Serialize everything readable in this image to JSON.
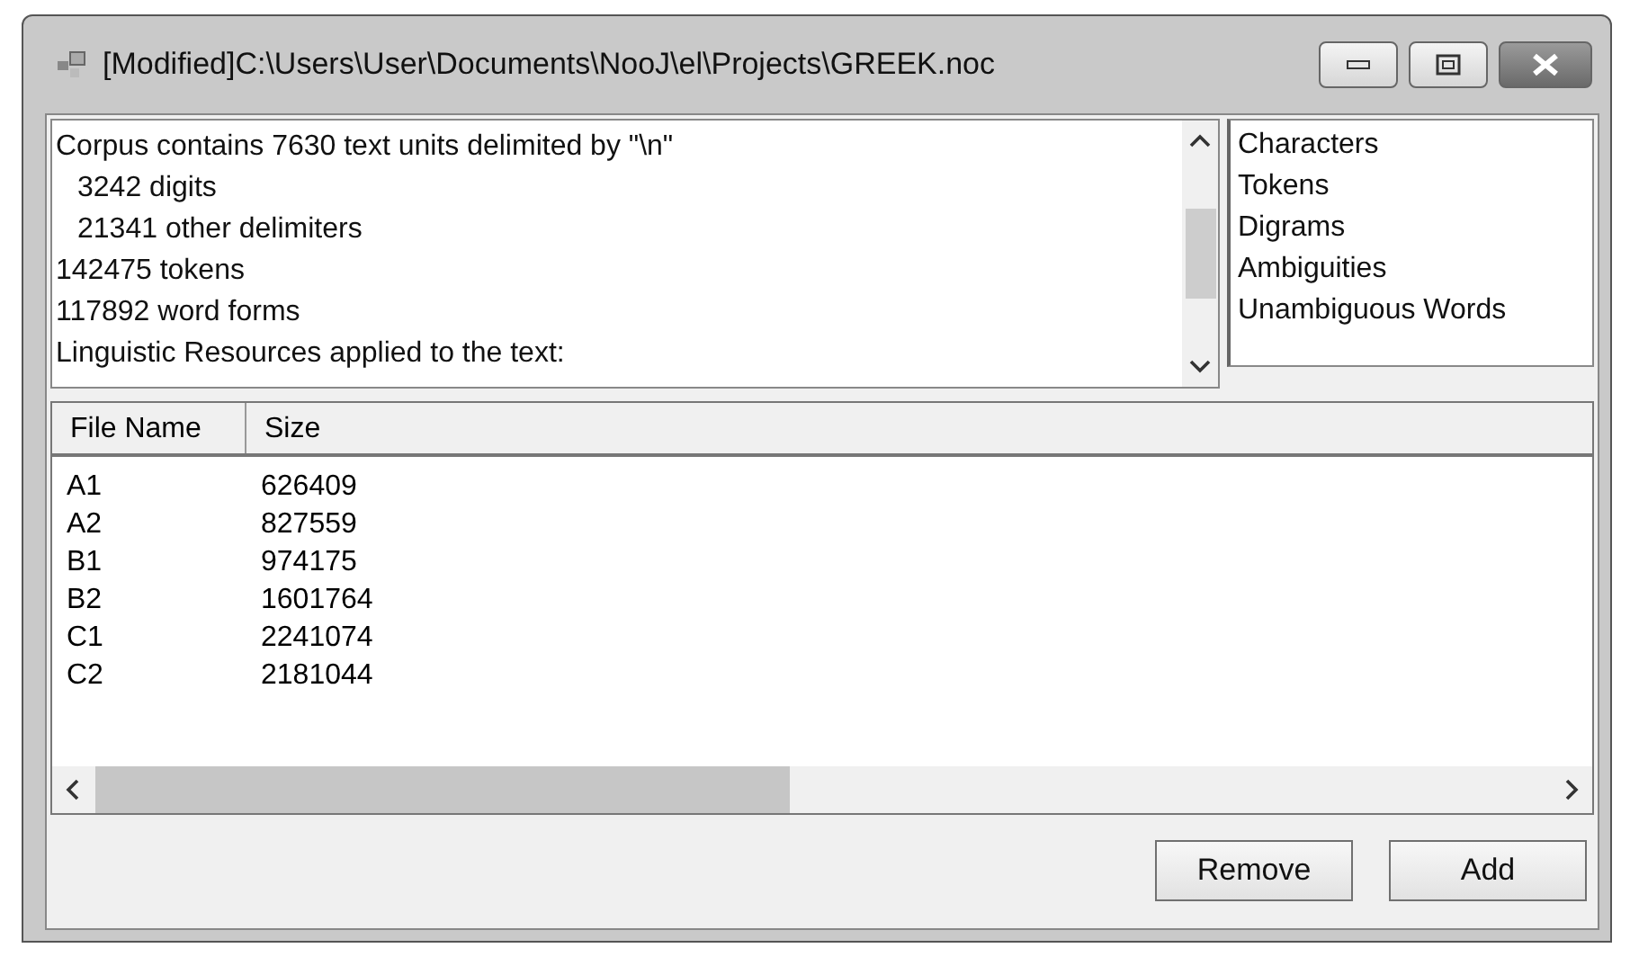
{
  "window": {
    "title": "[Modified]C:\\Users\\User\\Documents\\NooJ\\el\\Projects\\GREEK.noc"
  },
  "report": {
    "lines": [
      {
        "text": "Corpus contains 7630 text units delimited by \"\\n\"",
        "indented": false
      },
      {
        "text": "3242 digits",
        "indented": true
      },
      {
        "text": "21341 other delimiters",
        "indented": true
      },
      {
        "text": "142475 tokens",
        "indented": false
      },
      {
        "text": "117892 word forms",
        "indented": false
      },
      {
        "text": "Linguistic Resources applied to the text:",
        "indented": false
      }
    ]
  },
  "views": {
    "items": [
      "Characters",
      "Tokens",
      "Digrams",
      "Ambiguities",
      "Unambiguous Words"
    ]
  },
  "table": {
    "columns": [
      "File Name",
      "Size"
    ],
    "rows": [
      [
        "A1",
        "626409"
      ],
      [
        "A2",
        "827559"
      ],
      [
        "B1",
        "974175"
      ],
      [
        "B2",
        "1601764"
      ],
      [
        "C1",
        "2241074"
      ],
      [
        "C2",
        "2181044"
      ]
    ]
  },
  "buttons": [
    "Remove",
    "Add"
  ]
}
